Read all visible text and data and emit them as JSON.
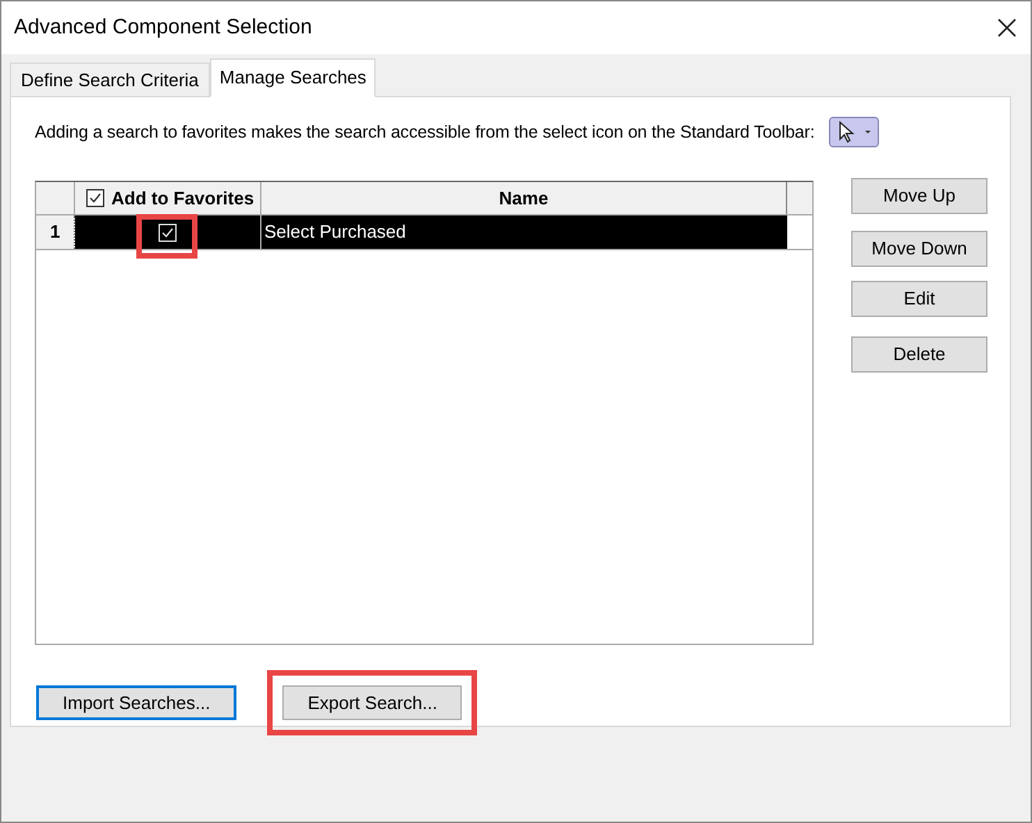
{
  "window": {
    "title": "Advanced Component Selection"
  },
  "tabs": [
    {
      "label": "Define Search Criteria",
      "selected": false
    },
    {
      "label": "Manage Searches",
      "selected": true
    }
  ],
  "info_text": "Adding a search to favorites makes the search accessible from the select icon on the Standard Toolbar:",
  "grid": {
    "header_checkbox_checked": true,
    "columns": [
      "Add to Favorites",
      "Name"
    ],
    "rows": [
      {
        "number": "1",
        "favorite": true,
        "name": "Select Purchased",
        "selected": true,
        "highlighted": true
      }
    ]
  },
  "side_buttons": [
    "Move Up",
    "Move Down",
    "Edit",
    "Delete"
  ],
  "bottom_buttons": [
    {
      "label": "Import Searches...",
      "focused": true,
      "highlighted": false
    },
    {
      "label": "Export Search...",
      "focused": false,
      "highlighted": true
    }
  ]
}
